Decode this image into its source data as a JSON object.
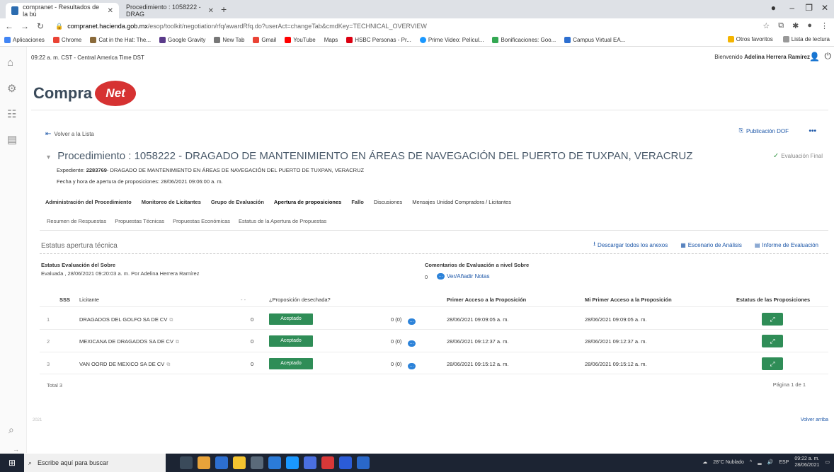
{
  "browser": {
    "tabs": [
      {
        "title": "compranet - Resultados de la bú"
      },
      {
        "title": "Procedimiento : 1058222 - DRAG"
      }
    ],
    "url_host": "compranet.hacienda.gob.mx",
    "url_rest": "/esop/toolkit/negotiation/rfq/awardRfq.do?userAct=changeTab&cmdKey=TECHNICAL_OVERVIEW",
    "bookmarks": [
      "Aplicaciones",
      "Chrome",
      "Cat in the Hat: The...",
      "Google Gravity",
      "New Tab",
      "Gmail",
      "YouTube",
      "Maps",
      "HSBC Personas - Pr...",
      "Prime Video: Películ...",
      "Bonificaciones: Goo...",
      "Campus Virtual EA..."
    ],
    "bookmarks_right": [
      "Otros favoritos",
      "Lista de lectura"
    ]
  },
  "header": {
    "timestamp": "09:22 a. m. CST - Central America Time DST",
    "welcome_prefix": "Bienvenido",
    "user_name": "Adelina Herrera Ramírez",
    "logo_text": "Compra",
    "logo_badge": "Net"
  },
  "page": {
    "back_link": "Volver a la Lista",
    "publicacion_dof": "Publicación DOF",
    "more": "•••",
    "title": "Procedimiento : 1058222 - DRAGADO DE MANTENIMIENTO EN ÁREAS DE NAVEGACIÓN DEL PUERTO DE TUXPAN, VERACRUZ",
    "status": "Evaluación Final",
    "expediente_label": "Expediente:",
    "expediente_id": "2283769",
    "expediente_desc": "- DRAGADO DE MANTENIMIENTO EN ÁREAS DE NAVEGACIÓN DEL PUERTO DE TUXPAN, VERACRUZ",
    "fecha": "Fecha y hora de apertura de proposiciones: 28/06/2021 09:06:00 a. m.",
    "main_tabs": [
      {
        "label": "Administración del Procedimiento"
      },
      {
        "label": "Monitoreo de Licitantes"
      },
      {
        "label": "Grupo de Evaluación"
      },
      {
        "label": "Apertura de proposiciones"
      },
      {
        "label": "Fallo"
      },
      {
        "label": "Discusiones"
      },
      {
        "label": "Mensajes Unidad Compradora / Licitantes"
      }
    ],
    "sub_tabs": [
      {
        "label": "Resumen de Respuestas"
      },
      {
        "label": "Propuestas Técnicas"
      },
      {
        "label": "Propuestas Económicas"
      },
      {
        "label": "Estatus de la Apertura de Propuestas"
      }
    ],
    "section_title": "Estatus apertura técnica",
    "actions": {
      "download": "Descargar todos los anexos",
      "escenario": "Escenario de Análisis",
      "informe": "Informe de Evaluación"
    },
    "estatus_label": "Estatus Evaluación del Sobre",
    "estatus_value": "Evaluada , 28/06/2021 09:20:03 a. m. Por Adelina Herrera Ramírez",
    "comentarios_label": "Comentarios de Evaluación a nivel Sobre",
    "comentarios_count": "0",
    "ver_notas": "Ver/Añadir Notas"
  },
  "table": {
    "headers": {
      "sss": "SSS",
      "licitante": "Licitante",
      "dash": "- -",
      "desechada": "¿Proposición desechada?",
      "primer_acceso": "Primer Acceso a la Proposición",
      "mi_primer_acceso": "Mi Primer Acceso a la Proposición",
      "estatus": "Estatus de las Proposiciones"
    },
    "rows": [
      {
        "num": "1",
        "licitante": "DRAGADOS DEL GOLFO SA DE CV",
        "score": "0",
        "estado": "Aceptado",
        "notes": "0 (0)",
        "primer": "28/06/2021 09:09:05 a. m.",
        "mi_primer": "28/06/2021 09:09:05 a. m."
      },
      {
        "num": "2",
        "licitante": "MEXICANA DE DRAGADOS SA DE CV",
        "score": "0",
        "estado": "Aceptado",
        "notes": "0 (0)",
        "primer": "28/06/2021 09:12:37 a. m.",
        "mi_primer": "28/06/2021 09:12:37 a. m."
      },
      {
        "num": "3",
        "licitante": "VAN OORD DE MEXICO SA DE CV",
        "score": "0",
        "estado": "Aceptado",
        "notes": "0 (0)",
        "primer": "28/06/2021 09:15:12 a. m.",
        "mi_primer": "28/06/2021 09:15:12 a. m."
      }
    ],
    "total": "Total 3",
    "page": "Página 1 de 1"
  },
  "footer": {
    "year": "2021",
    "volver_arriba": "Volver arriba"
  },
  "taskbar": {
    "search_placeholder": "Escribe aquí para buscar",
    "weather": "28°C Nublado",
    "lang": "ESP",
    "time": "09:22 a. m.",
    "date": "28/06/2021"
  },
  "colors": {
    "accent": "#1d57a8",
    "accept_green": "#2f8d57",
    "logo_red": "#d63232"
  }
}
